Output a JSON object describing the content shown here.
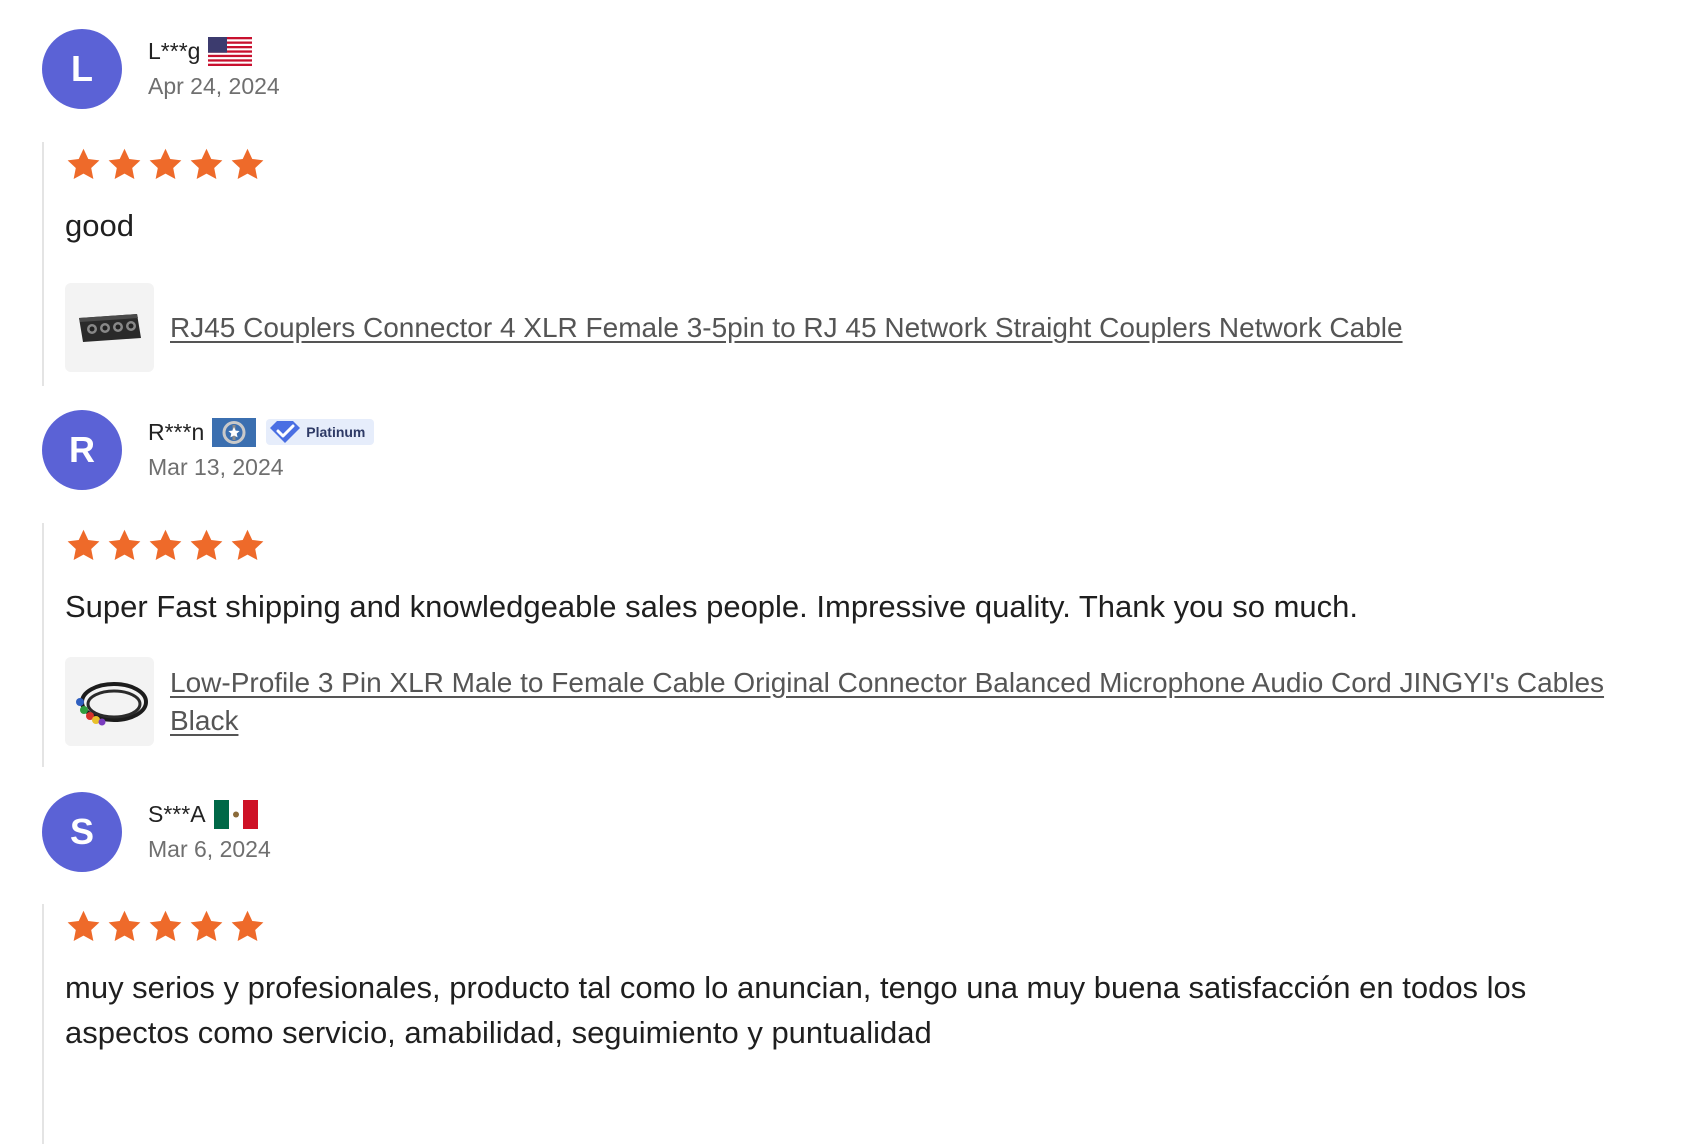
{
  "reviews": [
    {
      "avatar_letter": "L",
      "username": "L***g",
      "flag_icon": "us-flag-icon",
      "badge": null,
      "date": "Apr 24, 2024",
      "rating": 5,
      "text": "good",
      "product_title": "RJ45 Couplers Connector 4 XLR Female 3-5pin to RJ 45 Network Straight Couplers Network Cable",
      "product_thumb_icon": "xlr-coupler-box-thumbnail"
    },
    {
      "avatar_letter": "R",
      "username": "R***n",
      "flag_icon": "northern-mariana-islands-flag-icon",
      "badge": "Platinum",
      "date": "Mar 13, 2024",
      "rating": 5,
      "text": "Super Fast shipping and knowledgeable sales people. Impressive quality. Thank you so much.",
      "product_title": "Low-Profile 3 Pin XLR Male to Female Cable Original Connector Balanced Microphone Audio Cord JINGYI's Cables Black",
      "product_thumb_icon": "coiled-xlr-cables-thumbnail"
    },
    {
      "avatar_letter": "S",
      "username": "S***A",
      "flag_icon": "mexico-flag-icon",
      "badge": null,
      "date": "Mar 6, 2024",
      "rating": 5,
      "text": "muy serios y profesionales, producto tal como lo anuncian, tengo una muy buena satisfacción en todos los aspectos como servicio, amabilidad, seguimiento y puntualidad",
      "product_title": null
    }
  ],
  "colors": {
    "avatar_bg": "#5b62d6",
    "star": "#ee6a2a",
    "badge_bg": "#e6edfb",
    "badge_check": "#4a6fe3"
  }
}
